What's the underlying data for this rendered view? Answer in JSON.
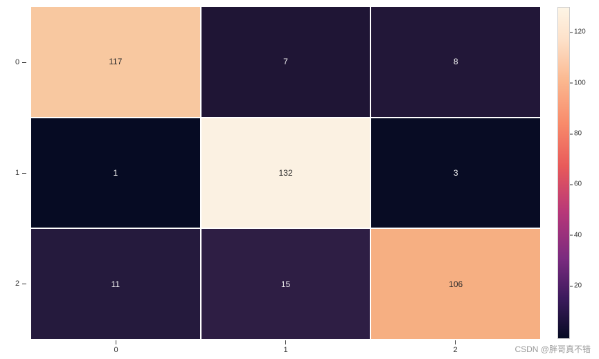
{
  "chart_data": {
    "type": "heatmap",
    "x_categories": [
      "0",
      "1",
      "2"
    ],
    "y_categories": [
      "0",
      "1",
      "2"
    ],
    "values": [
      [
        117,
        7,
        8
      ],
      [
        1,
        132,
        3
      ],
      [
        11,
        15,
        106
      ]
    ],
    "xlabel": "",
    "ylabel": "",
    "title": "",
    "colorbar": {
      "min": 1,
      "max": 132,
      "ticks": [
        20,
        40,
        60,
        80,
        100,
        120
      ]
    }
  },
  "colors": {
    "c117": "#f8c8a0",
    "c7": "#1f1535",
    "c8": "#221738",
    "c1": "#060b23",
    "c132": "#fbf1e2",
    "c3": "#080c24",
    "c11": "#251a3d",
    "c15": "#2e1e44",
    "c106": "#f6af82"
  },
  "watermark": "CSDN @胖哥真不错"
}
